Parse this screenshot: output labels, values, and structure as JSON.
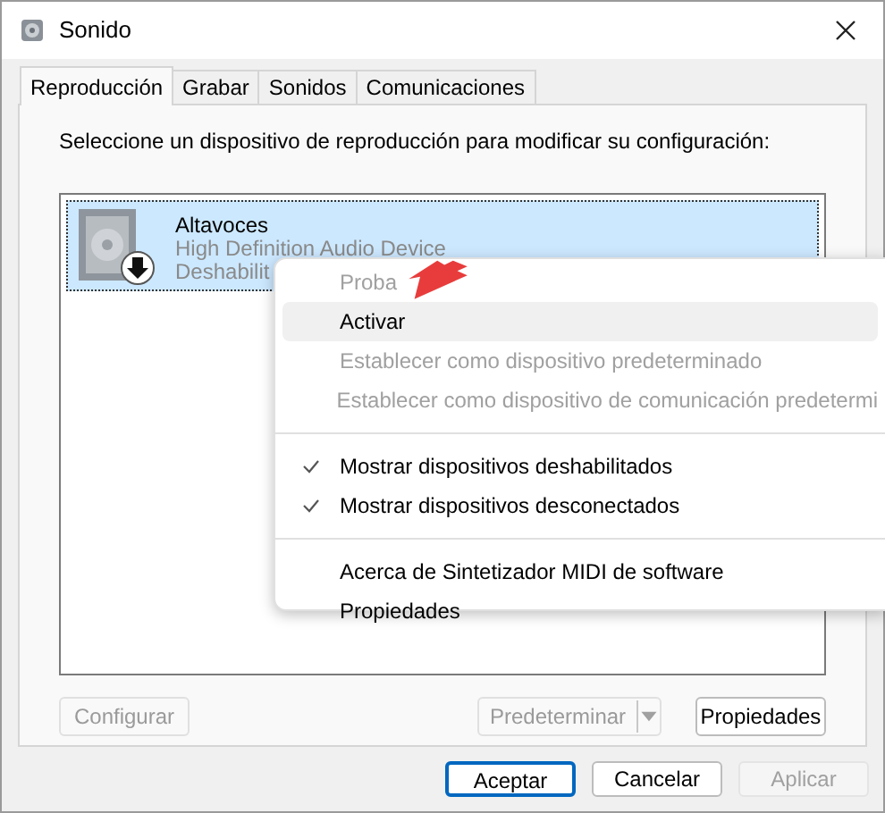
{
  "window": {
    "title": "Sonido"
  },
  "tabs": [
    {
      "label": "Reproducción",
      "selected": true
    },
    {
      "label": "Grabar",
      "selected": false
    },
    {
      "label": "Sonidos",
      "selected": false
    },
    {
      "label": "Comunicaciones",
      "selected": false
    }
  ],
  "instruction": "Seleccione un dispositivo de reproducción para modificar su configuración:",
  "devices": [
    {
      "name": "Altavoces",
      "description": "High Definition Audio Device",
      "status": "Deshabilit",
      "selected": true,
      "disabled": true
    }
  ],
  "context_menu": {
    "items": [
      {
        "kind": "item",
        "label": "Proba",
        "disabled": true,
        "checked": false,
        "selected": false
      },
      {
        "kind": "item",
        "label": "Activar",
        "disabled": false,
        "checked": false,
        "selected": true
      },
      {
        "kind": "item",
        "label": "Establecer como dispositivo predeterminado",
        "disabled": true,
        "checked": false,
        "selected": false
      },
      {
        "kind": "item",
        "label": "Establecer como dispositivo de comunicación predetermi",
        "disabled": true,
        "checked": false,
        "selected": false
      },
      {
        "kind": "separator"
      },
      {
        "kind": "item",
        "label": "Mostrar dispositivos deshabilitados",
        "disabled": false,
        "checked": true,
        "selected": false
      },
      {
        "kind": "item",
        "label": "Mostrar dispositivos desconectados",
        "disabled": false,
        "checked": true,
        "selected": false
      },
      {
        "kind": "separator"
      },
      {
        "kind": "item",
        "label": "Acerca de Sintetizador MIDI de software",
        "disabled": false,
        "checked": false,
        "selected": false
      },
      {
        "kind": "item",
        "label": "Propiedades",
        "disabled": false,
        "checked": false,
        "selected": false
      }
    ]
  },
  "panel_buttons": [
    {
      "kind": "button",
      "label": "Configurar",
      "disabled": true
    },
    {
      "kind": "split",
      "label": "Predeterminar",
      "disabled": true
    },
    {
      "kind": "button",
      "label": "Propiedades",
      "disabled": false
    }
  ],
  "dialog_buttons": [
    {
      "label": "Aceptar",
      "disabled": false,
      "default": true
    },
    {
      "label": "Cancelar",
      "disabled": false,
      "default": false
    },
    {
      "label": "Aplicar",
      "disabled": true,
      "default": false
    }
  ]
}
